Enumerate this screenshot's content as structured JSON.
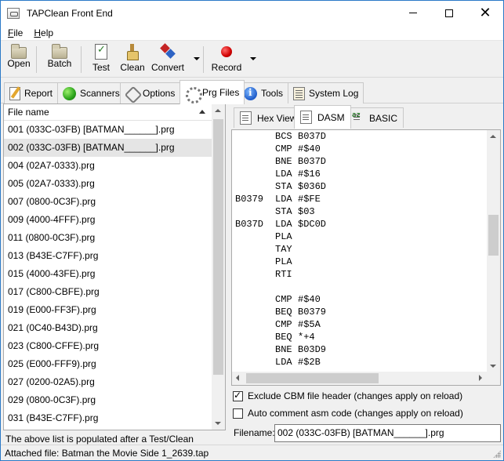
{
  "window": {
    "title": "TAPClean Front End"
  },
  "menu": [
    {
      "label": "File",
      "accel": "F",
      "rest": "ile"
    },
    {
      "label": "Help",
      "accel": "H",
      "rest": "elp"
    }
  ],
  "toolbar": {
    "open": "Open",
    "batch": "Batch",
    "test": "Test",
    "clean": "Clean",
    "convert": "Convert",
    "record": "Record",
    "icons": {
      "open": "folder-icon",
      "batch": "folder-icon",
      "test": "checklist-icon",
      "clean": "broom-icon",
      "convert": "convert-icon",
      "record": "record-icon"
    }
  },
  "main_tabs": [
    {
      "label": "Report",
      "icon": "report-icon"
    },
    {
      "label": "Scanners",
      "icon": "green-ball-icon"
    },
    {
      "label": "Options",
      "icon": "options-icon"
    },
    {
      "label": "Prg Files",
      "icon": "gear-disc-icon",
      "active": true
    },
    {
      "label": "Tools",
      "icon": "info-icon"
    },
    {
      "label": "System Log",
      "icon": "log-icon"
    }
  ],
  "file_list": {
    "header": "File name",
    "selected_index": 1,
    "items": [
      "001 (033C-03FB) [BATMAN______].prg",
      "002 (033C-03FB) [BATMAN______].prg",
      "004 (02A7-0333).prg",
      "005 (02A7-0333).prg",
      "007 (0800-0C3F).prg",
      "009 (4000-4FFF).prg",
      "011 (0800-0C3F).prg",
      "013 (B43E-C7FF).prg",
      "015 (4000-43FE).prg",
      "017 (C800-CBFE).prg",
      "019 (E000-FF3F).prg",
      "021 (0C40-B43D).prg",
      "023 (C800-CFFE).prg",
      "025 (E000-FFF9).prg",
      "027 (0200-02A5).prg",
      "029 (0800-0C3F).prg",
      "031 (B43E-C7FF).prg"
    ],
    "footer": "The above list is populated after a Test/Clean"
  },
  "sub_tabs": [
    {
      "label": "Hex View",
      "icon": "document-icon"
    },
    {
      "label": "DASM",
      "icon": "document-icon",
      "active": true
    },
    {
      "label": "BASIC",
      "icon": "basic-icon"
    }
  ],
  "code": [
    {
      "label": "",
      "op": "BCS",
      "arg": "B037D"
    },
    {
      "label": "",
      "op": "CMP",
      "arg": "#$40"
    },
    {
      "label": "",
      "op": "BNE",
      "arg": "B037D"
    },
    {
      "label": "",
      "op": "LDA",
      "arg": "#$16"
    },
    {
      "label": "",
      "op": "STA",
      "arg": "$036D"
    },
    {
      "label": "B0379",
      "op": "LDA",
      "arg": "#$FE"
    },
    {
      "label": "",
      "op": "STA",
      "arg": "$03"
    },
    {
      "label": "B037D",
      "op": "LDA",
      "arg": "$DC0D"
    },
    {
      "label": "",
      "op": "PLA",
      "arg": ""
    },
    {
      "label": "",
      "op": "TAY",
      "arg": ""
    },
    {
      "label": "",
      "op": "PLA",
      "arg": ""
    },
    {
      "label": "",
      "op": "RTI",
      "arg": ""
    },
    {
      "label": "",
      "op": "",
      "arg": ""
    },
    {
      "label": "",
      "op": "CMP",
      "arg": "#$40"
    },
    {
      "label": "",
      "op": "BEQ",
      "arg": "B0379"
    },
    {
      "label": "",
      "op": "CMP",
      "arg": "#$5A"
    },
    {
      "label": "",
      "op": "BEQ",
      "arg": "*+4"
    },
    {
      "label": "",
      "op": "BNE",
      "arg": "B03D9"
    },
    {
      "label": "",
      "op": "LDA",
      "arg": "#$2B"
    }
  ],
  "options": {
    "exclude_header": {
      "label": "Exclude CBM file header (changes apply on reload)",
      "checked": true
    },
    "auto_comment": {
      "label": "Auto comment asm code (changes apply on reload)",
      "checked": false
    }
  },
  "filename": {
    "label": "Filename:",
    "value": "002 (033C-03FB) [BATMAN______].prg"
  },
  "status": {
    "attached": "Attached file: Batman the Movie Side 1_2639.tap"
  }
}
